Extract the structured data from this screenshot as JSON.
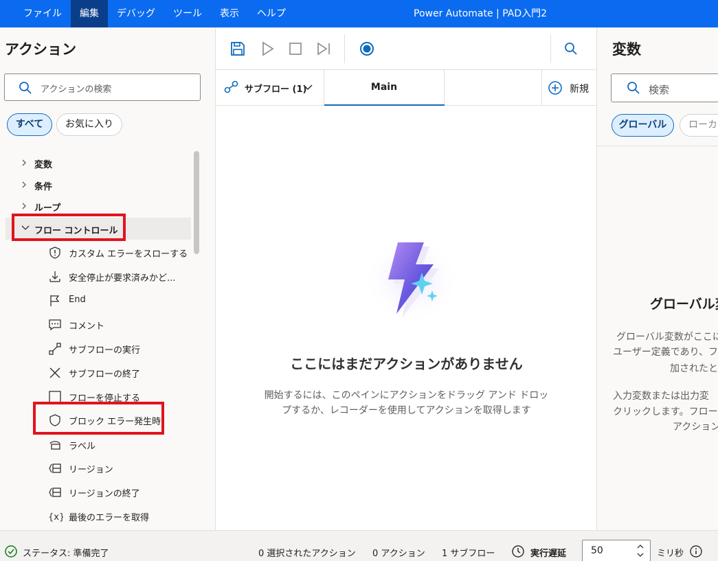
{
  "menubar": {
    "items": [
      "ファイル",
      "編集",
      "デバッグ",
      "ツール",
      "表示",
      "ヘルプ"
    ],
    "active_index": 1,
    "title": "Power Automate | PAD入門2"
  },
  "actions_panel": {
    "title": "アクション",
    "search_placeholder": "アクションの検索",
    "filters": {
      "all": "すべて",
      "favorites": "お気に入り"
    },
    "top_groups": [
      "変数",
      "条件",
      "ループ"
    ],
    "expanded_group": "フロー コントロール",
    "sub_items": [
      {
        "label": "カスタム エラーをスローする",
        "icon": "shield-alert-icon"
      },
      {
        "label": "安全停止が要求済みかど...",
        "icon": "stop-request-icon"
      },
      {
        "label": "End",
        "icon": "flag-icon"
      },
      {
        "label": "コメント",
        "icon": "comment-icon"
      },
      {
        "label": "サブフローの実行",
        "icon": "subflow-run-icon"
      },
      {
        "label": "サブフローの終了",
        "icon": "close-x-icon"
      },
      {
        "label": "フローを停止する",
        "icon": "stop-square-icon"
      },
      {
        "label": "ブロック エラー発生時",
        "icon": "shield-icon"
      },
      {
        "label": "ラベル",
        "icon": "label-icon"
      },
      {
        "label": "リージョン",
        "icon": "region-icon"
      },
      {
        "label": "リージョンの終了",
        "icon": "region-end-icon"
      },
      {
        "label": "最後のエラーを取得",
        "icon": "variable-braces-icon"
      }
    ]
  },
  "designer": {
    "subflow_tab": "サブフロー (1)",
    "main_tab": "Main",
    "new_label": "新規",
    "empty_title": "ここにはまだアクションがありません",
    "empty_desc_line1": "開始するには、このペインにアクションをドラッグ アンド ドロッ",
    "empty_desc_line2": "プするか、レコーダーを使用してアクションを取得します"
  },
  "variables_panel": {
    "title": "変数",
    "search_placeholder": "検索",
    "filter_global": "グローバル",
    "filter_local": "ローカル",
    "global_title": "グローバル変",
    "text_lines": [
      "グローバル変数がここに",
      "ユーザー定義であり、フ",
      "加されたと",
      "入力変数または出力変",
      "クリックします。フロー変",
      "アクション"
    ]
  },
  "statusbar": {
    "status": "ステータス: 準備完了",
    "selected_actions": "0 選択されたアクション",
    "actions": "0 アクション",
    "subflows": "1 サブフロー",
    "delay_label": "実行遅延",
    "delay_value": "50",
    "delay_unit": "ミリ秒"
  },
  "colors": {
    "accent": "#0a6bf0",
    "active_menu": "#0a3e8a",
    "highlight_box": "#e0141e",
    "selection_blue": "#0f6cbd"
  }
}
